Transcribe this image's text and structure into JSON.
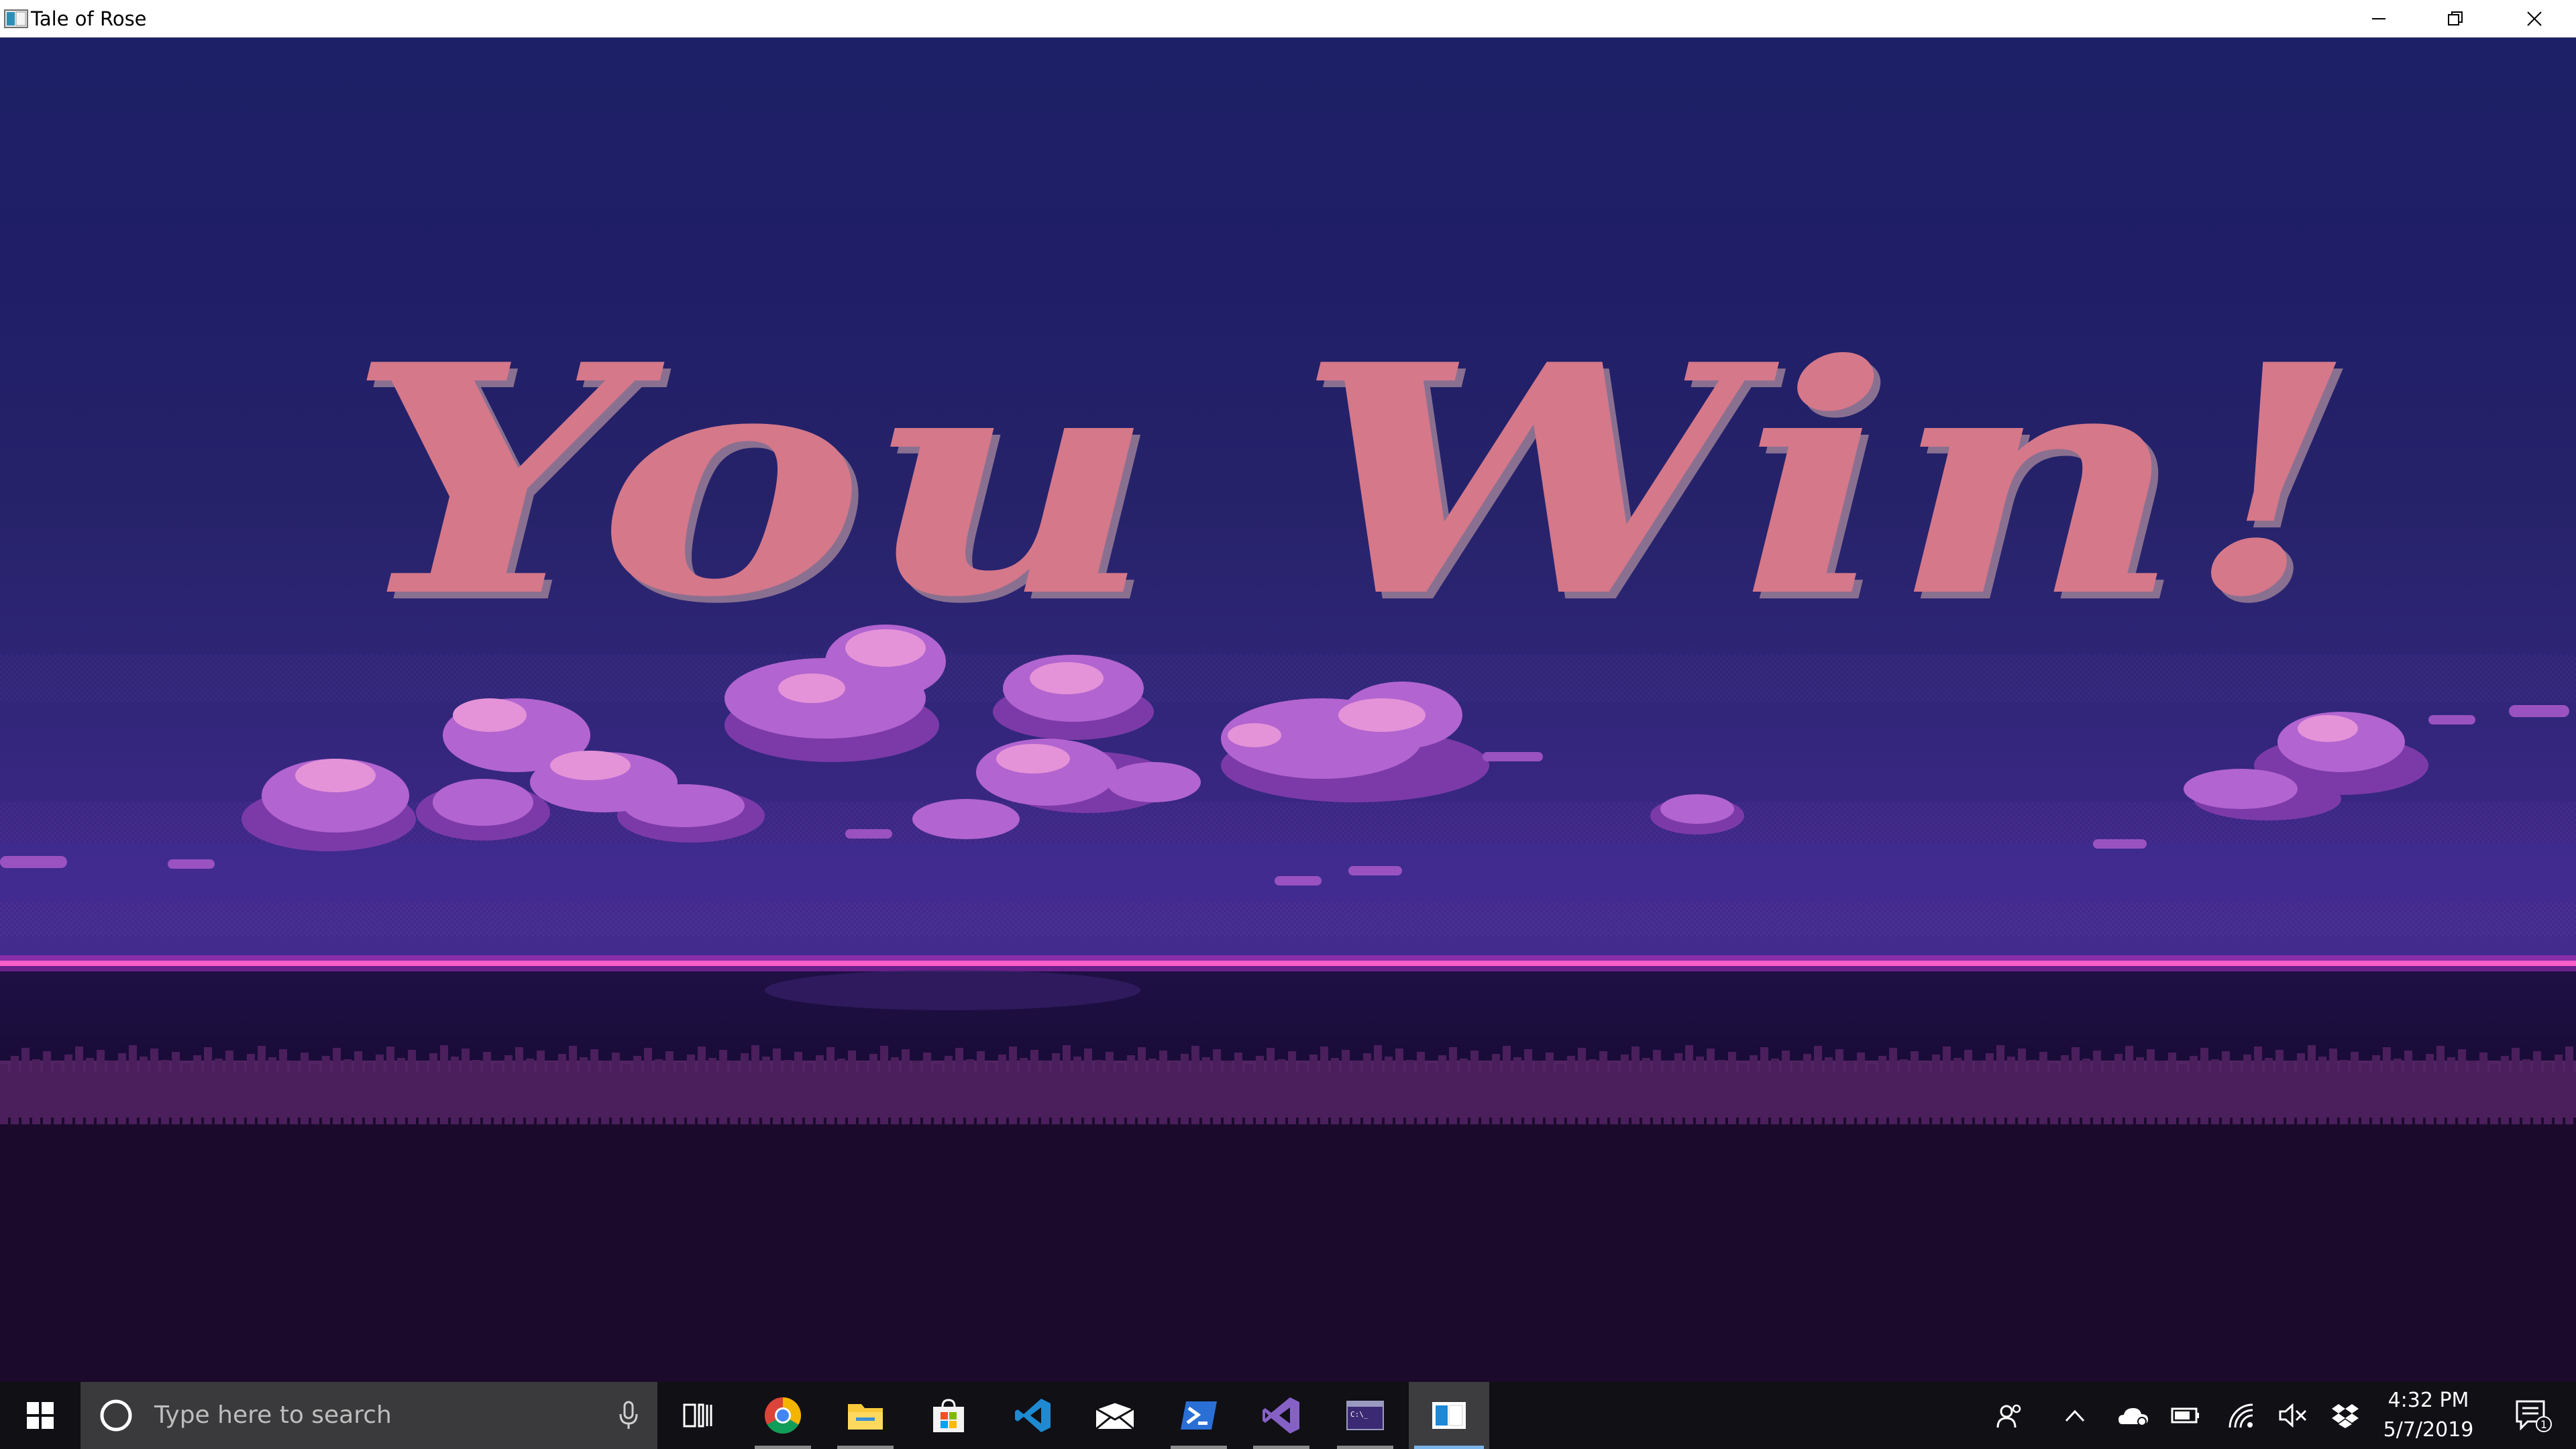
{
  "window": {
    "title": "Tale of Rose",
    "controls": {
      "minimize": "minimize",
      "restore": "restore",
      "close": "close"
    }
  },
  "game": {
    "headline": "You Win!",
    "colors": {
      "sky_top": "#1d2066",
      "sky_bottom": "#432c8e",
      "text_fill": "#d5788a",
      "text_shadow": "#8a7090",
      "cloud_light": "#e493d8",
      "cloud_mid": "#b264d0",
      "cloud_dark": "#7c3aa8",
      "horizon_line": "#ff5fc8",
      "ground": "#1c0a2c"
    }
  },
  "taskbar": {
    "search_placeholder": "Type here to search",
    "pinned_apps": [
      {
        "name": "Task View",
        "icon": "task-view-icon",
        "active": false
      },
      {
        "name": "Google Chrome",
        "icon": "chrome-icon",
        "active": true
      },
      {
        "name": "File Explorer",
        "icon": "folder-icon",
        "active": true
      },
      {
        "name": "Microsoft Store",
        "icon": "store-icon",
        "active": false
      },
      {
        "name": "Visual Studio Code",
        "icon": "vscode-icon",
        "active": false
      },
      {
        "name": "Mail",
        "icon": "mail-icon",
        "active": false
      },
      {
        "name": "PowerShell",
        "icon": "powershell-icon",
        "active": true
      },
      {
        "name": "Visual Studio",
        "icon": "visual-studio-icon",
        "active": true
      },
      {
        "name": "Command Prompt",
        "icon": "terminal-icon",
        "active": true
      },
      {
        "name": "Tale of Rose",
        "icon": "app-window-icon",
        "active": true,
        "focused": true
      }
    ],
    "tray": {
      "icons": [
        "people-icon",
        "chevron-up-icon",
        "onedrive-icon",
        "battery-icon",
        "wifi-icon",
        "volume-muted-icon",
        "dropbox-icon"
      ],
      "time": "4:32 PM",
      "date": "5/7/2019",
      "notification_count": "1"
    }
  }
}
